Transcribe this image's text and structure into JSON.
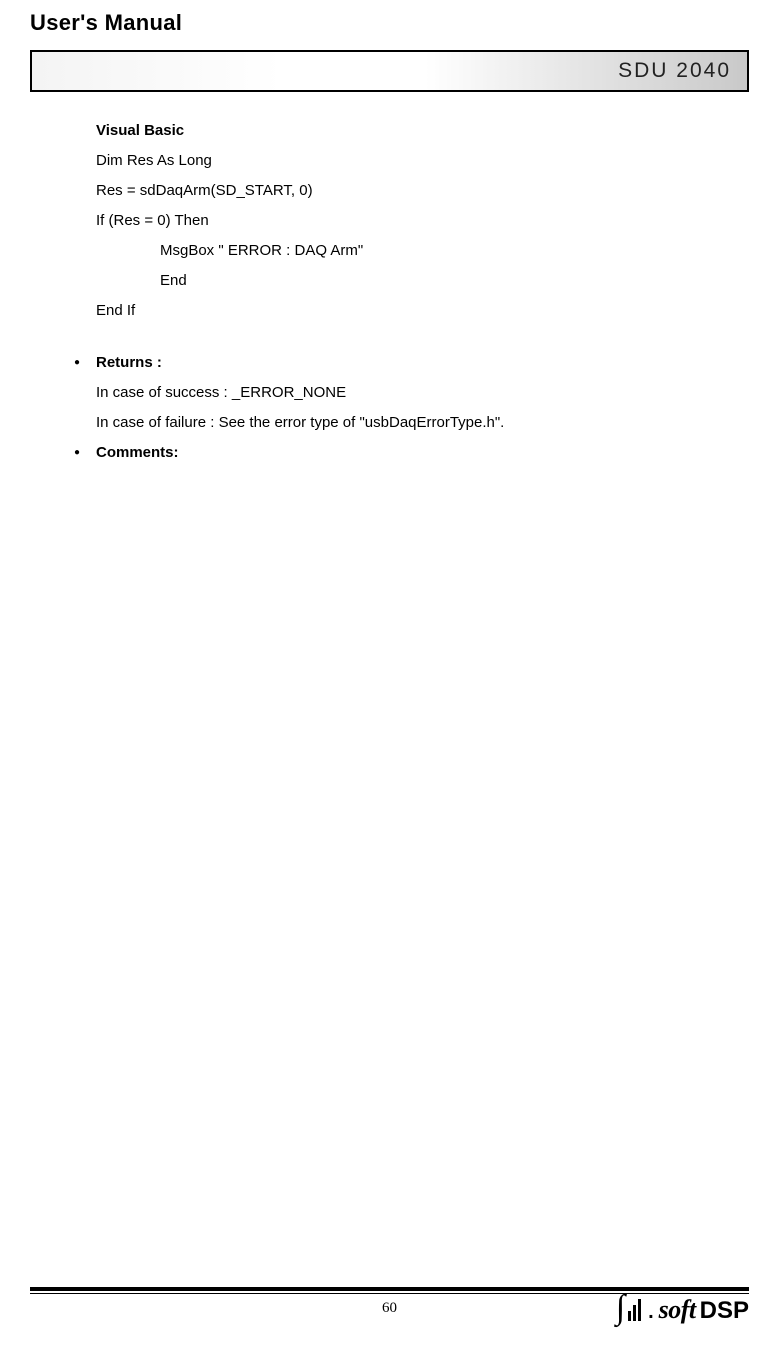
{
  "header": {
    "title": "User's Manual",
    "banner": "SDU 2040"
  },
  "code": {
    "heading": "Visual Basic",
    "lines": {
      "l1": "Dim Res  As Long",
      "l2": "Res = sdDaqArm(SD_START, 0)",
      "l3": "If (Res = 0) Then",
      "l4": "MsgBox \" ERROR : DAQ Arm\"",
      "l5": "End",
      "l6": "End If"
    }
  },
  "sections": {
    "returns": {
      "label": "Returns :",
      "line1": "In case of success : _ERROR_NONE",
      "line2": "In case of failure : See the error type of \"usbDaqErrorType.h\"."
    },
    "comments": {
      "label": "Comments:"
    }
  },
  "footer": {
    "page": "60",
    "logo_soft": "soft",
    "logo_dsp": "DSP"
  }
}
